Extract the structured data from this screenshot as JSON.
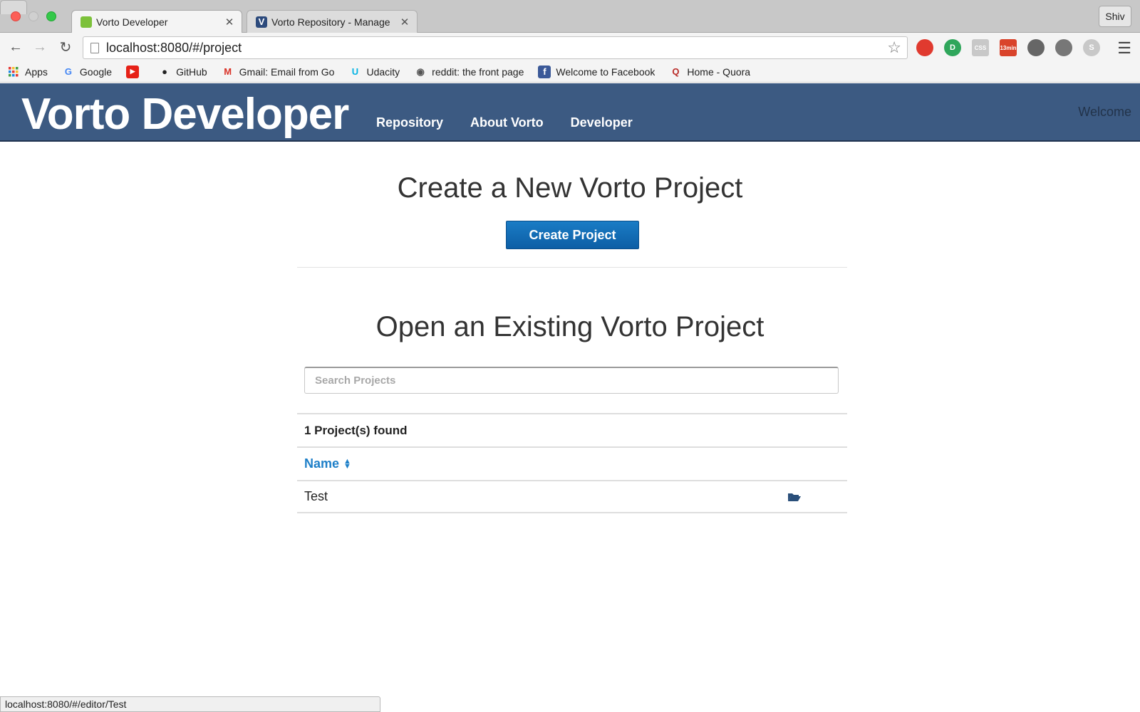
{
  "browser": {
    "tabs": [
      {
        "title": "Vorto Developer",
        "active": true
      },
      {
        "title": "Vorto Repository - Manage",
        "active": false
      }
    ],
    "profile": "Shiv",
    "url": "localhost:8080/#/project",
    "extensions": [
      {
        "name": "shield-ext-icon",
        "label": "",
        "color": "#e03a2f"
      },
      {
        "name": "d-ext-icon",
        "label": "D",
        "color": "#2fa65b"
      },
      {
        "name": "css-ext-icon",
        "label": "CSS",
        "color": "#c8c8c8"
      },
      {
        "name": "timer-ext-icon",
        "label": "13min",
        "color": "#d9432b"
      },
      {
        "name": "plug-ext-icon",
        "label": "",
        "color": "#666666"
      },
      {
        "name": "cast-icon",
        "label": "",
        "color": "#777777"
      },
      {
        "name": "skype-ext-icon",
        "label": "S",
        "color": "#c8c8c8"
      }
    ],
    "bookmarks": [
      {
        "name": "apps",
        "label": "Apps",
        "icon": "grid",
        "color": "#e44"
      },
      {
        "name": "google",
        "label": "Google",
        "icon": "G",
        "color": "#4285f4"
      },
      {
        "name": "youtube",
        "label": "",
        "icon": "▶",
        "color": "#e62117"
      },
      {
        "name": "github",
        "label": "GitHub",
        "icon": "●",
        "color": "#222222"
      },
      {
        "name": "gmail",
        "label": "Gmail: Email from Go",
        "icon": "M",
        "color": "#d93025"
      },
      {
        "name": "udacity",
        "label": "Udacity",
        "icon": "U",
        "color": "#02b3e4"
      },
      {
        "name": "reddit",
        "label": "reddit: the front page",
        "icon": "◉",
        "color": "#555555"
      },
      {
        "name": "facebook",
        "label": "Welcome to Facebook",
        "icon": "f",
        "color": "#3b5998"
      },
      {
        "name": "quora",
        "label": "Home - Quora",
        "icon": "Q",
        "color": "#b92b27"
      }
    ],
    "status_url": "localhost:8080/#/editor/Test"
  },
  "header": {
    "brand": "Vorto Developer",
    "nav": [
      "Repository",
      "About Vorto",
      "Developer"
    ],
    "welcome": "Welcome"
  },
  "create": {
    "title": "Create a New Vorto Project",
    "button": "Create Project"
  },
  "open": {
    "title": "Open an Existing Vorto Project",
    "search_placeholder": "Search Projects",
    "found_text": "1 Project(s) found",
    "column_name": "Name",
    "projects": [
      {
        "name": "Test"
      }
    ]
  },
  "colors": {
    "header_bg": "#3c5a82",
    "accent_blue": "#1d7fc8",
    "button_blue": "#0d5ea5",
    "folder_icon": "#2a4f7a"
  }
}
